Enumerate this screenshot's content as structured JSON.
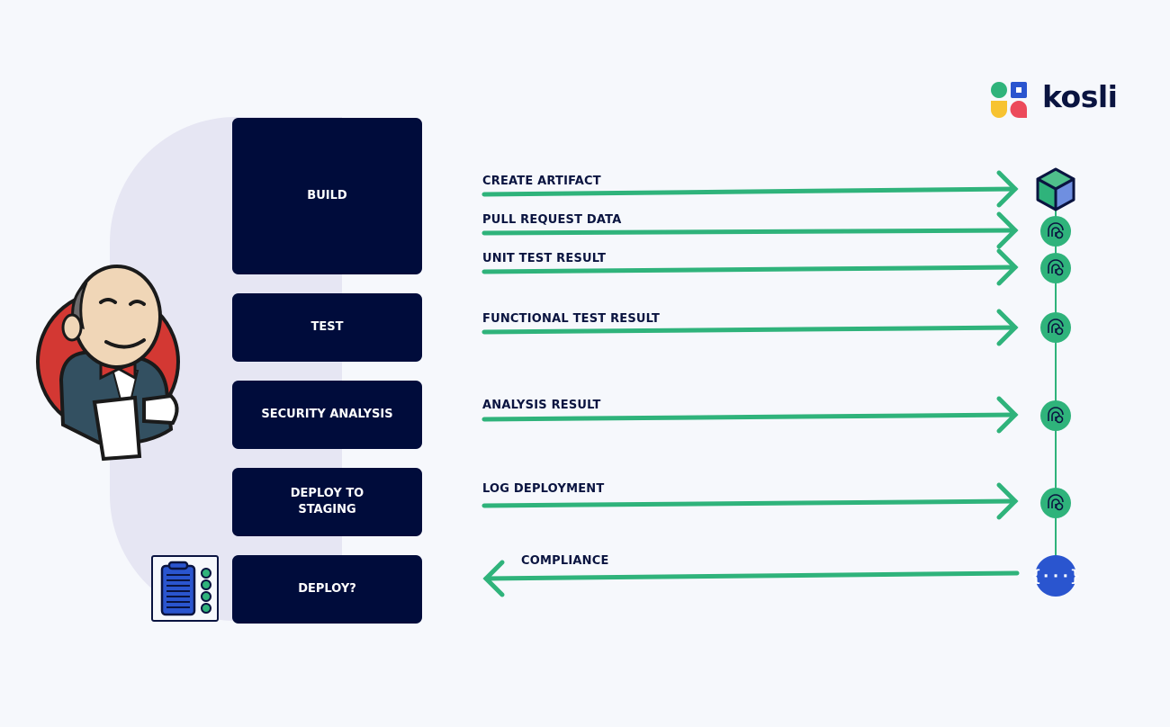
{
  "brand": {
    "name": "kosli",
    "colors": {
      "green": "#2fb37b",
      "navy": "#000c3b",
      "blue": "#2a55cf",
      "yellow": "#f7c331",
      "red": "#ec4a5b",
      "lavender": "#e6e6f3"
    }
  },
  "stages": [
    {
      "label": "BUILD"
    },
    {
      "label": "TEST"
    },
    {
      "label": "SECURITY ANALYSIS"
    },
    {
      "label": "DEPLOY TO\nSTAGING"
    },
    {
      "label": "DEPLOY?"
    }
  ],
  "flows": [
    {
      "label": "CREATE ARTIFACT",
      "direction": "right",
      "target_icon": "artifact-cube-icon"
    },
    {
      "label": "PULL REQUEST DATA",
      "direction": "right",
      "target_icon": "fingerprint-search-icon"
    },
    {
      "label": "UNIT TEST RESULT",
      "direction": "right",
      "target_icon": "fingerprint-search-icon"
    },
    {
      "label": "FUNCTIONAL TEST RESULT",
      "direction": "right",
      "target_icon": "fingerprint-search-icon"
    },
    {
      "label": "ANALYSIS RESULT",
      "direction": "right",
      "target_icon": "fingerprint-search-icon"
    },
    {
      "label": "LOG DEPLOYMENT",
      "direction": "right",
      "target_icon": "fingerprint-search-icon"
    },
    {
      "label": "COMPLIANCE",
      "direction": "left",
      "source_icon": "api-braces-icon"
    }
  ],
  "icons": {
    "mascot": "jenkins-butler-icon",
    "checklist": "clipboard-checklist-icon"
  }
}
